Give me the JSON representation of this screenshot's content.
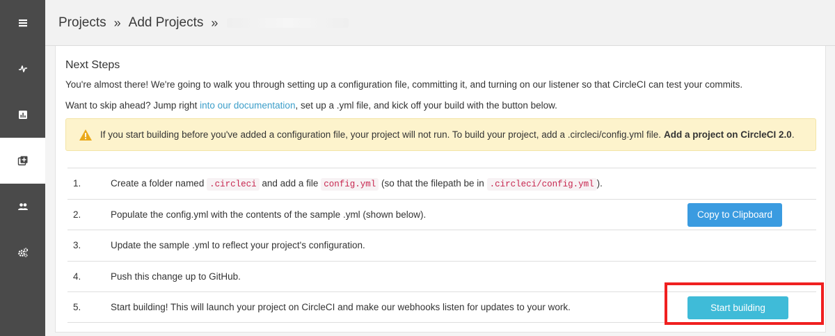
{
  "sidebar": {
    "items": [
      {
        "name": "dashboard",
        "icon": "list-icon",
        "active": false
      },
      {
        "name": "insights",
        "icon": "pulse-icon",
        "active": false
      },
      {
        "name": "stats",
        "icon": "bar-chart-icon",
        "active": false
      },
      {
        "name": "add-projects",
        "icon": "add-project-icon",
        "active": true
      },
      {
        "name": "team",
        "icon": "people-icon",
        "active": false
      },
      {
        "name": "settings",
        "icon": "gears-icon",
        "active": false
      }
    ]
  },
  "header": {
    "crumb1": "Projects",
    "sep": "»",
    "crumb2": "Add Projects"
  },
  "main": {
    "title": "Next Steps",
    "intro": "You're almost there! We're going to walk you through setting up a configuration file, committing it, and turning on our listener so that CircleCI can test your commits.",
    "skip_pre": "Want to skip ahead? Jump right ",
    "skip_link": "into our documentation",
    "skip_post": ", set up a .yml file, and kick off your build with the button below.",
    "alert_text": "If you start building before you've added a configuration file, your project will not run. To build your project, add a .circleci/config.yml file.",
    "alert_link": "Add a project on CircleCI 2.0",
    "alert_end": "."
  },
  "steps": {
    "s1": {
      "num": "1.",
      "t1": "Create a folder named ",
      "c1": ".circleci",
      "t2": " and add a file ",
      "c2": "config.yml",
      "t3": " (so that the filepath be in ",
      "c3": ".circleci/config.yml",
      "t4": ")."
    },
    "s2": {
      "num": "2.",
      "text": "Populate the config.yml with the contents of the sample .yml (shown below).",
      "button": "Copy to Clipboard"
    },
    "s3": {
      "num": "3.",
      "text": "Update the sample .yml to reflect your project's configuration."
    },
    "s4": {
      "num": "4.",
      "text": "Push this change up to GitHub."
    },
    "s5": {
      "num": "5.",
      "text": "Start building! This will launch your project on CircleCI and make our webhooks listen for updates to your work.",
      "button": "Start building"
    }
  },
  "colors": {
    "sidebar": "#4a4a4a",
    "link": "#3b9ec9",
    "alert_bg": "#fdf3cc",
    "copy_button": "#3a9be0",
    "start_button": "#3fbbd8",
    "highlight": "#f02020"
  }
}
